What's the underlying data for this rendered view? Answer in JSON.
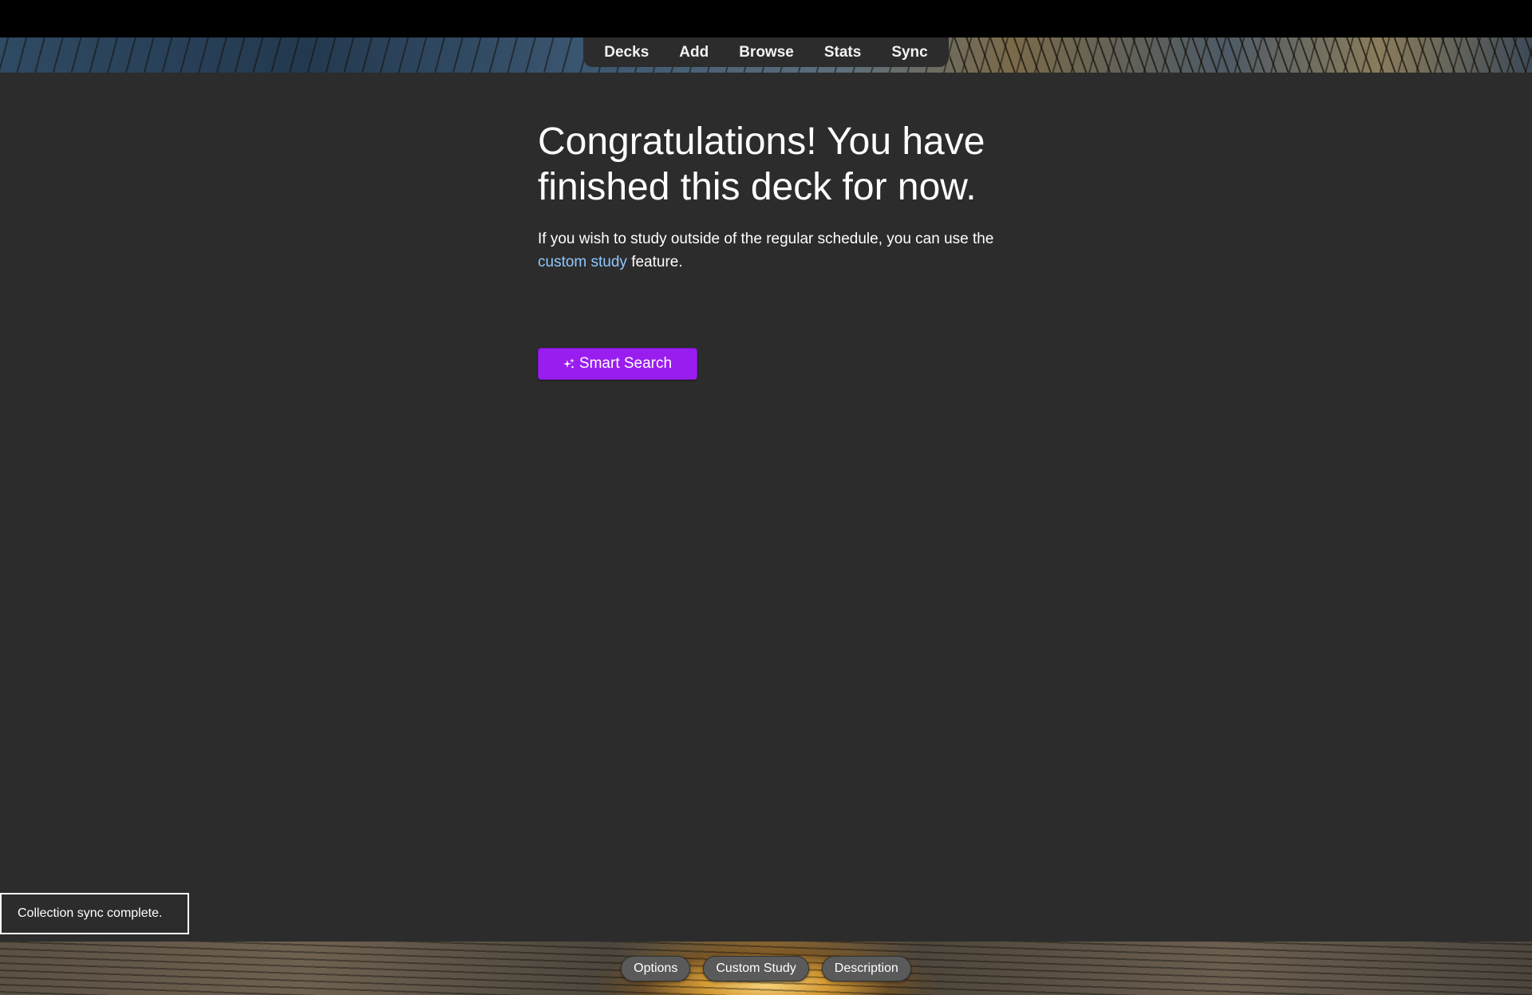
{
  "toolbar": {
    "items": [
      "Decks",
      "Add",
      "Browse",
      "Stats",
      "Sync"
    ]
  },
  "overview": {
    "heading": "Congratulations! You have finished this deck for now.",
    "para_before": "If you wish to study outside of the regular schedule, you can use the ",
    "link": "custom study",
    "para_after": " feature.",
    "smart_search_label": "Smart Search",
    "smart_search_color": "#9a1df0",
    "smart_search_icon": "sparkle-icon"
  },
  "toast": {
    "message": "Collection sync complete."
  },
  "bottom": {
    "buttons": [
      "Options",
      "Custom Study",
      "Description"
    ]
  }
}
